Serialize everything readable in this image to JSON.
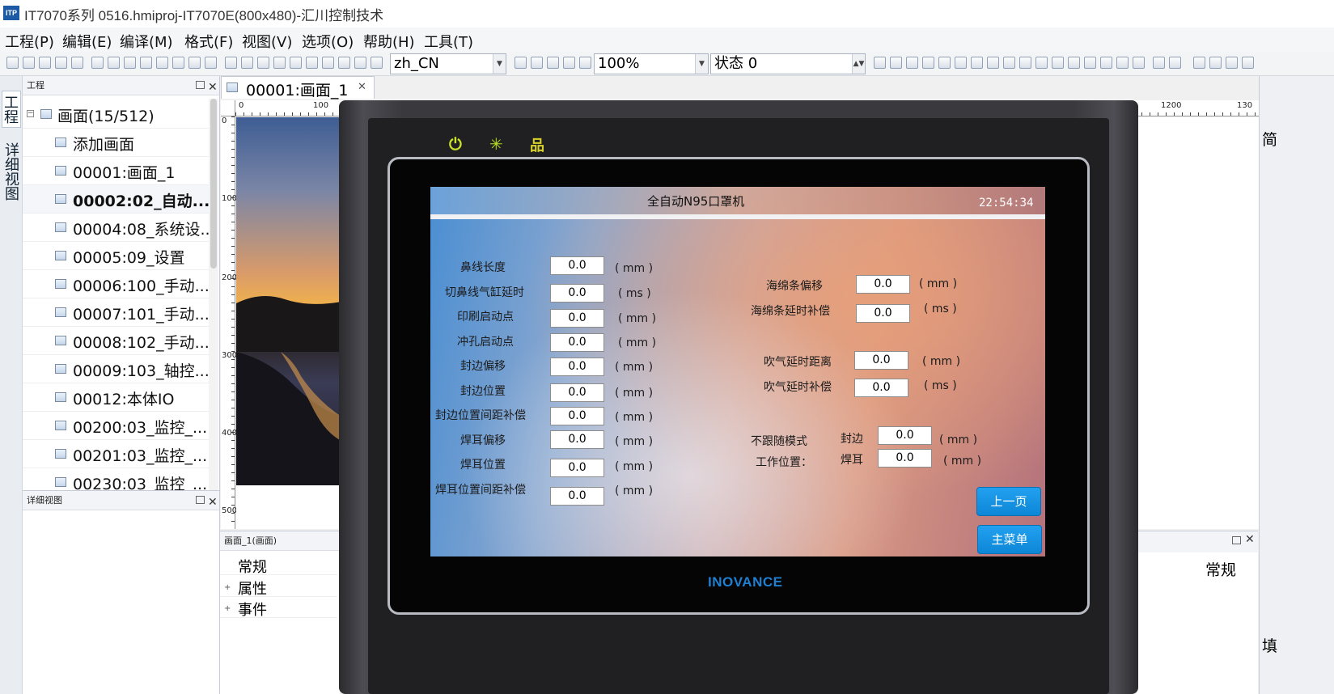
{
  "window": {
    "title": "IT7070系列 0516.hmiproj-IT7070E(800x480)-汇川控制技术",
    "logo_text": "ITP"
  },
  "menu": [
    "工程(P)",
    "编辑(E)",
    "编译(M)",
    "格式(F)",
    "视图(V)",
    "选项(O)",
    "帮助(H)",
    "工具(T)"
  ],
  "toolbar": {
    "language": "zh_CN",
    "zoom": "100%",
    "state": "状态 0"
  },
  "left_tabs": {
    "project": "工程",
    "detail": "详细视图"
  },
  "project_panel": {
    "title": "工程",
    "root": "画面(15/512)",
    "items": [
      {
        "label": "添加画面",
        "icon": "add-screen-icon",
        "bold": false
      },
      {
        "label": "00001:画面_1",
        "icon": "screen-icon",
        "bold": false
      },
      {
        "label": "00002:02_自动...",
        "icon": "screen-icon",
        "bold": true
      },
      {
        "label": "00004:08_系统设...",
        "icon": "screen-icon",
        "bold": false
      },
      {
        "label": "00005:09_设置",
        "icon": "screen-icon",
        "bold": false
      },
      {
        "label": "00006:100_手动...",
        "icon": "screen-icon",
        "bold": false
      },
      {
        "label": "00007:101_手动...",
        "icon": "screen-icon",
        "bold": false
      },
      {
        "label": "00008:102_手动...",
        "icon": "screen-icon",
        "bold": false
      },
      {
        "label": "00009:103_轴控...",
        "icon": "screen-icon",
        "bold": false
      },
      {
        "label": "00012:本体IO",
        "icon": "screen-icon",
        "bold": false
      },
      {
        "label": "00200:03_监控_...",
        "icon": "screen-icon",
        "bold": false
      },
      {
        "label": "00201:03_监控_...",
        "icon": "screen-icon",
        "bold": false
      },
      {
        "label": "00230:03_监控_...",
        "icon": "screen-icon",
        "bold": false
      }
    ]
  },
  "detail_panel": {
    "title": "详细视图"
  },
  "document": {
    "tab_label": "00001:画面_1",
    "ruler_top": [
      "0",
      "100",
      "1200",
      "130"
    ],
    "ruler_left": [
      "0",
      "100",
      "200",
      "300",
      "400",
      "500"
    ]
  },
  "properties_panel": {
    "title": "画面_1(画面)",
    "rows": [
      {
        "label": "常规",
        "expander": ""
      },
      {
        "label": "属性",
        "expander": "+"
      },
      {
        "label": "事件",
        "expander": "+"
      }
    ]
  },
  "right_panel": {
    "general": "常规",
    "strip_top": "简",
    "strip_bottom": "填"
  },
  "hmi": {
    "brand": "INOVANCE",
    "title": "全自动N95口罩机",
    "clock": "22:54:34",
    "left_params": [
      {
        "label": "鼻线长度",
        "value": "0.0",
        "unit": "( mm )"
      },
      {
        "label": "切鼻线气缸延时",
        "value": "0.0",
        "unit": "( ms )"
      },
      {
        "label": "印刷启动点",
        "value": "0.0",
        "unit": "( mm )"
      },
      {
        "label": "冲孔启动点",
        "value": "0.0",
        "unit": "( mm )"
      },
      {
        "label": "封边偏移",
        "value": "0.0",
        "unit": "( mm )"
      },
      {
        "label": "封边位置",
        "value": "0.0",
        "unit": "( mm )"
      },
      {
        "label": "封边位置间距补偿",
        "value": "0.0",
        "unit": "( mm )"
      },
      {
        "label": "焊耳偏移",
        "value": "0.0",
        "unit": "( mm )"
      },
      {
        "label": "焊耳位置",
        "value": "0.0",
        "unit": "( mm )"
      },
      {
        "label": "焊耳位置间距补偿",
        "value": "0.0",
        "unit": "( mm )"
      }
    ],
    "right_params": [
      {
        "label": "海绵条偏移",
        "value": "0.0",
        "unit": "( mm )"
      },
      {
        "label": "海绵条延时补偿",
        "value": "0.0",
        "unit": "( ms )"
      },
      {
        "label": "吹气延时距离",
        "value": "0.0",
        "unit": "( mm )"
      },
      {
        "label": "吹气延时补偿",
        "value": "0.0",
        "unit": "( ms )"
      }
    ],
    "no_follow": {
      "label_line1": "不跟随模式",
      "label_line2": "工作位置：",
      "rows": [
        {
          "label": "封边",
          "value": "0.0",
          "unit": "( mm )"
        },
        {
          "label": "焊耳",
          "value": "0.0",
          "unit": "( mm )"
        }
      ]
    },
    "buttons": {
      "prev": "上一页",
      "main_menu": "主菜单"
    }
  }
}
